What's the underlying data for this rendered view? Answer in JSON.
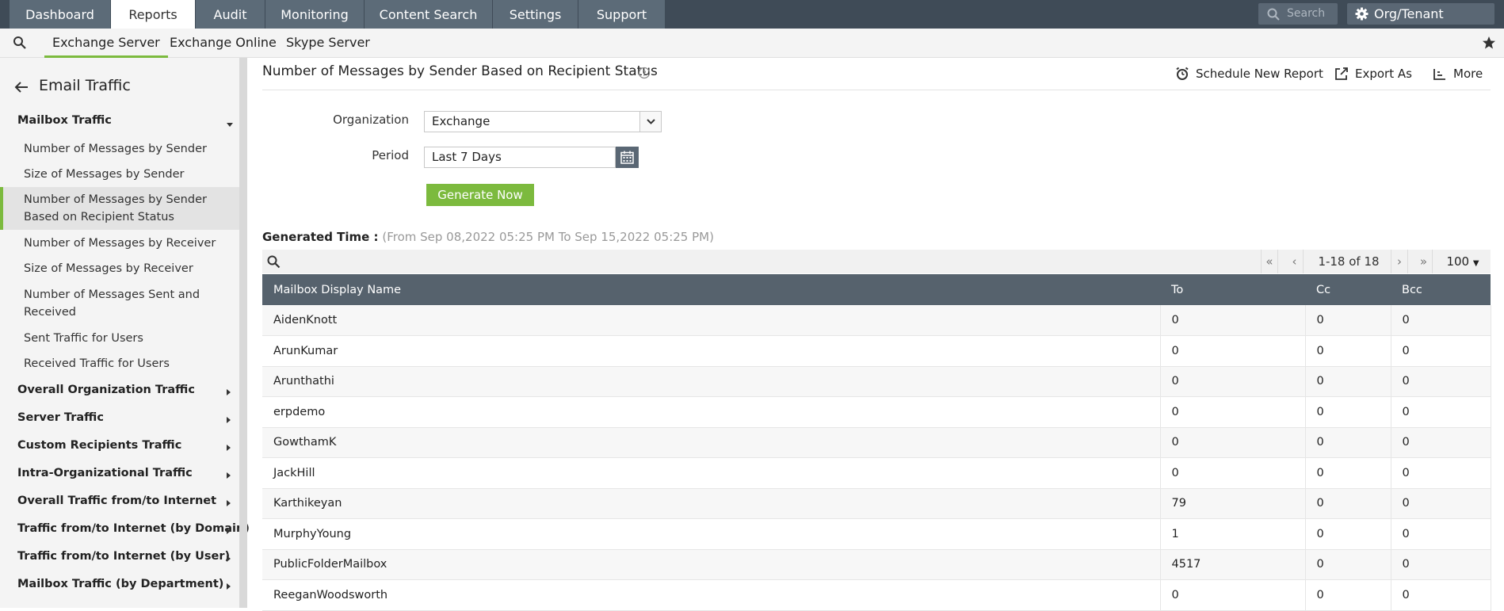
{
  "topnav": {
    "tabs": [
      "Dashboard",
      "Reports",
      "Audit",
      "Monitoring",
      "Content Search",
      "Settings",
      "Support"
    ],
    "active_tab": "Reports",
    "search_placeholder": "Search",
    "settings_label": "Org/Tenant Settings"
  },
  "subnav": {
    "tabs": [
      "Exchange Server",
      "Exchange Online",
      "Skype Server"
    ],
    "active_tab": "Exchange Server"
  },
  "sidebar": {
    "title": "Email Traffic",
    "groups": [
      {
        "label": "Mailbox Traffic",
        "expanded": true,
        "items": [
          "Number of Messages by Sender",
          "Size of Messages by Sender",
          "Number of Messages by Sender Based on Recipient Status",
          "Number of Messages by Receiver",
          "Size of Messages by Receiver",
          "Number of Messages Sent and Received",
          "Sent Traffic for Users",
          "Received Traffic for Users"
        ],
        "active_item": "Number of Messages by Sender Based on Recipient Status"
      },
      {
        "label": "Overall Organization Traffic",
        "expanded": false
      },
      {
        "label": "Server Traffic",
        "expanded": false
      },
      {
        "label": "Custom Recipients Traffic",
        "expanded": false
      },
      {
        "label": "Intra-Organizational Traffic",
        "expanded": false
      },
      {
        "label": "Overall Traffic from/to Internet",
        "expanded": false
      },
      {
        "label": "Traffic from/to Internet (by Domain)",
        "expanded": false
      },
      {
        "label": "Traffic from/to Internet (by User)",
        "expanded": false
      },
      {
        "label": "Mailbox Traffic (by Department)",
        "expanded": false
      }
    ]
  },
  "main": {
    "title": "Number of Messages by Sender Based on Recipient Status",
    "actions": {
      "schedule": "Schedule New Report",
      "export": "Export As",
      "more": "More"
    },
    "form": {
      "organization_label": "Organization",
      "organization_value": "Exchange",
      "period_label": "Period",
      "period_value": "Last 7 Days",
      "generate_label": "Generate Now"
    },
    "generated": {
      "label": "Generated Time :",
      "range": "(From Sep 08,2022 05:25 PM To Sep 15,2022 05:25 PM)"
    },
    "pagination": {
      "range": "1-18 of 18",
      "page_size": "100"
    },
    "table": {
      "columns": [
        "Mailbox Display Name",
        "To",
        "Cc",
        "Bcc"
      ],
      "rows": [
        [
          "AidenKnott",
          "0",
          "0",
          "0"
        ],
        [
          "ArunKumar",
          "0",
          "0",
          "0"
        ],
        [
          "Arunthathi",
          "0",
          "0",
          "0"
        ],
        [
          "erpdemo",
          "0",
          "0",
          "0"
        ],
        [
          "GowthamK",
          "0",
          "0",
          "0"
        ],
        [
          "JackHill",
          "0",
          "0",
          "0"
        ],
        [
          "Karthikeyan",
          "79",
          "0",
          "0"
        ],
        [
          "MurphyYoung",
          "1",
          "0",
          "0"
        ],
        [
          "PublicFolderMailbox",
          "4517",
          "0",
          "0"
        ],
        [
          "ReeganWoodsworth",
          "0",
          "0",
          "0"
        ]
      ]
    }
  },
  "colors": {
    "topnav_bg": "#3f4b57",
    "accent_green": "#7cba3e",
    "table_header_bg": "#56626d"
  }
}
